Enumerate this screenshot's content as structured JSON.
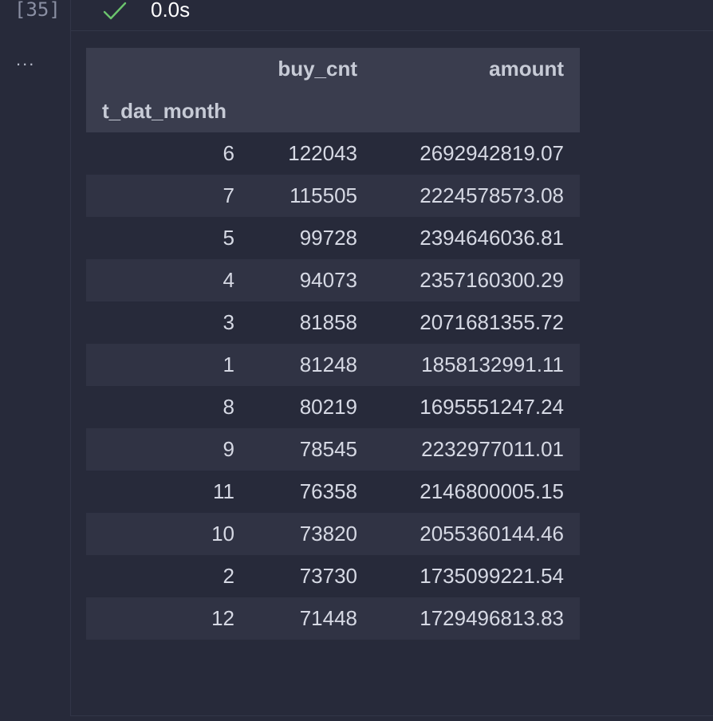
{
  "cell": {
    "execution_count": "[35]",
    "status_icon": "check-icon",
    "exec_time": "0.0s",
    "output_toolbar": "..."
  },
  "dataframe": {
    "columns": [
      "buy_cnt",
      "amount"
    ],
    "index_name": "t_dat_month",
    "rows": [
      [
        "6",
        "122043",
        "2692942819.07"
      ],
      [
        "7",
        "115505",
        "2224578573.08"
      ],
      [
        "5",
        "99728",
        "2394646036.81"
      ],
      [
        "4",
        "94073",
        "2357160300.29"
      ],
      [
        "3",
        "81858",
        "2071681355.72"
      ],
      [
        "1",
        "81248",
        "1858132991.11"
      ],
      [
        "8",
        "80219",
        "1695551247.24"
      ],
      [
        "9",
        "78545",
        "2232977011.01"
      ],
      [
        "11",
        "76358",
        "2146800005.15"
      ],
      [
        "10",
        "73820",
        "2055360144.46"
      ],
      [
        "2",
        "73730",
        "1735099221.54"
      ],
      [
        "12",
        "71448",
        "1729496813.83"
      ]
    ]
  },
  "colors": {
    "background": "#272a3a",
    "header_bg": "#3a3d4e",
    "stripe_bg": "#303344",
    "check": "#6bc46d"
  }
}
